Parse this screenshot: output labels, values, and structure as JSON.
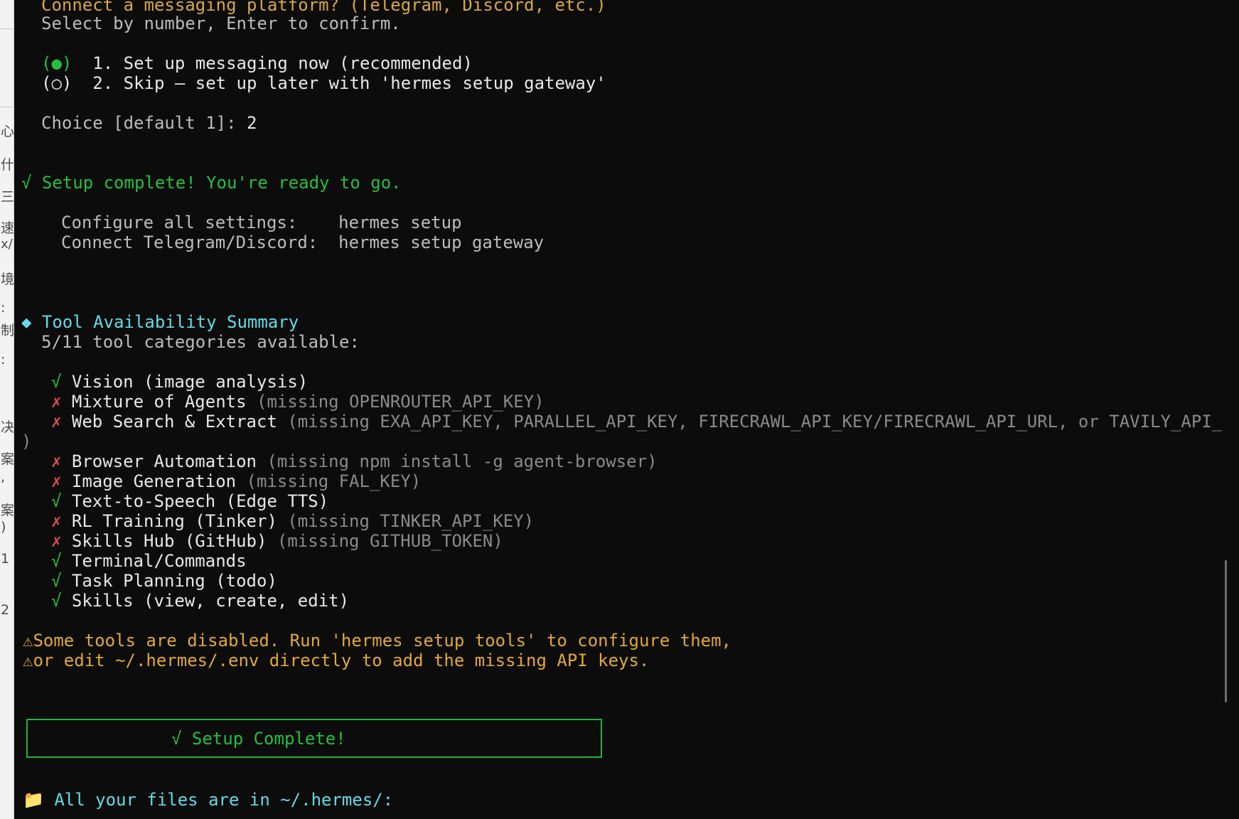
{
  "sidebar_glyphs": [
    "心",
    "什",
    "三",
    "速",
    "x/r",
    "境",
    ":",
    "制",
    ":",
    "决",
    "案",
    ",",
    "案",
    ")",
    "1",
    "2"
  ],
  "prompt": {
    "title": "Connect a messaging platform? (Telegram, Discord, etc.)",
    "hint": "Select by number, Enter to confirm.",
    "options": [
      {
        "marker": "(●)",
        "label": "1. Set up messaging now (recommended)"
      },
      {
        "marker": "(○)",
        "label": "2. Skip — set up later with 'hermes setup gateway'"
      }
    ],
    "choice_label": "Choice [default 1]: ",
    "choice_value": "2"
  },
  "complete": {
    "check": "√",
    "message": "Setup complete! You're ready to go.",
    "settings": [
      {
        "label": "Configure all settings:",
        "command": "hermes setup"
      },
      {
        "label": "Connect Telegram/Discord:",
        "command": "hermes setup gateway"
      }
    ]
  },
  "summary": {
    "bullet": "◆",
    "title": "Tool Availability Summary",
    "count_text": "5/11 tool categories available:",
    "tools": [
      {
        "status": "√",
        "name": "Vision (image analysis)",
        "note": ""
      },
      {
        "status": "✗",
        "name": "Mixture of Agents",
        "note": "(missing OPENROUTER_API_KEY)"
      },
      {
        "status": "✗",
        "name": "Web Search & Extract",
        "note": "(missing EXA_API_KEY, PARALLEL_API_KEY, FIRECRAWL_API_KEY/FIRECRAWL_API_URL, or TAVILY_API_KEY",
        "wrap": ")"
      },
      {
        "status": "✗",
        "name": "Browser Automation",
        "note": "(missing npm install -g agent-browser)"
      },
      {
        "status": "✗",
        "name": "Image Generation",
        "note": "(missing FAL_KEY)"
      },
      {
        "status": "√",
        "name": "Text-to-Speech (Edge TTS)",
        "note": ""
      },
      {
        "status": "✗",
        "name": "RL Training (Tinker)",
        "note": "(missing TINKER_API_KEY)"
      },
      {
        "status": "✗",
        "name": "Skills Hub (GitHub)",
        "note": "(missing GITHUB_TOKEN)"
      },
      {
        "status": "√",
        "name": "Terminal/Commands",
        "note": ""
      },
      {
        "status": "√",
        "name": "Task Planning (todo)",
        "note": ""
      },
      {
        "status": "√",
        "name": "Skills (view, create, edit)",
        "note": ""
      }
    ]
  },
  "warnings": {
    "icon": "⚠",
    "line1": "Some tools are disabled. Run 'hermes setup tools' to configure them,",
    "line2": "or edit ~/.hermes/.env directly to add the missing API keys."
  },
  "banner": {
    "text": "√ Setup Complete!"
  },
  "files": {
    "icon": "📁",
    "text": "All your files are in ~/.hermes/:"
  },
  "colors": {
    "background": "#0c0c0c",
    "yellow": "#d9a93c",
    "green": "#24c03c",
    "red": "#e34b4b",
    "cyan": "#63dbe6",
    "gray": "#bcbcbc"
  }
}
